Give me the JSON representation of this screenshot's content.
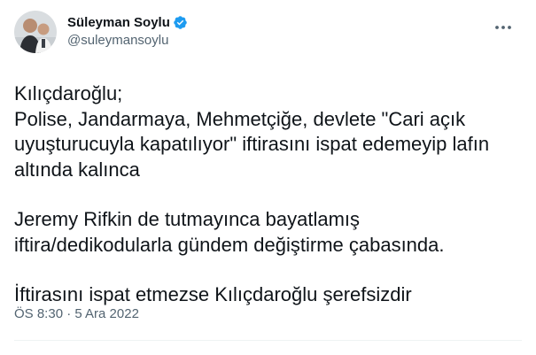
{
  "author": {
    "display_name": "Süleyman Soylu",
    "handle": "@suleymansoylu",
    "verified": true
  },
  "tweet": {
    "lines": [
      "Kılıçdaroğlu;",
      "Polise, Jandarmaya, Mehmetçiğe, devlete \"Cari açık",
      "uyuşturucuyla kapatılıyor\" iftirasını ispat edemeyip lafın",
      "altında kalınca",
      "",
      "Jeremy Rifkin de tutmayınca bayatlamış",
      "iftira/dedikodularla gündem değiştirme çabasında.",
      "",
      "İftirasını ispat etmezse Kılıçdaroğlu şerefsizdir"
    ],
    "timestamp": "ÖS 8:30 · 5 Ara 2022"
  },
  "colors": {
    "verified_badge": "#1d9bf0",
    "secondary_text": "#536471",
    "primary_text": "#0f1419"
  },
  "icons": {
    "verified": "verified-badge-icon",
    "more": "more-options-icon"
  }
}
